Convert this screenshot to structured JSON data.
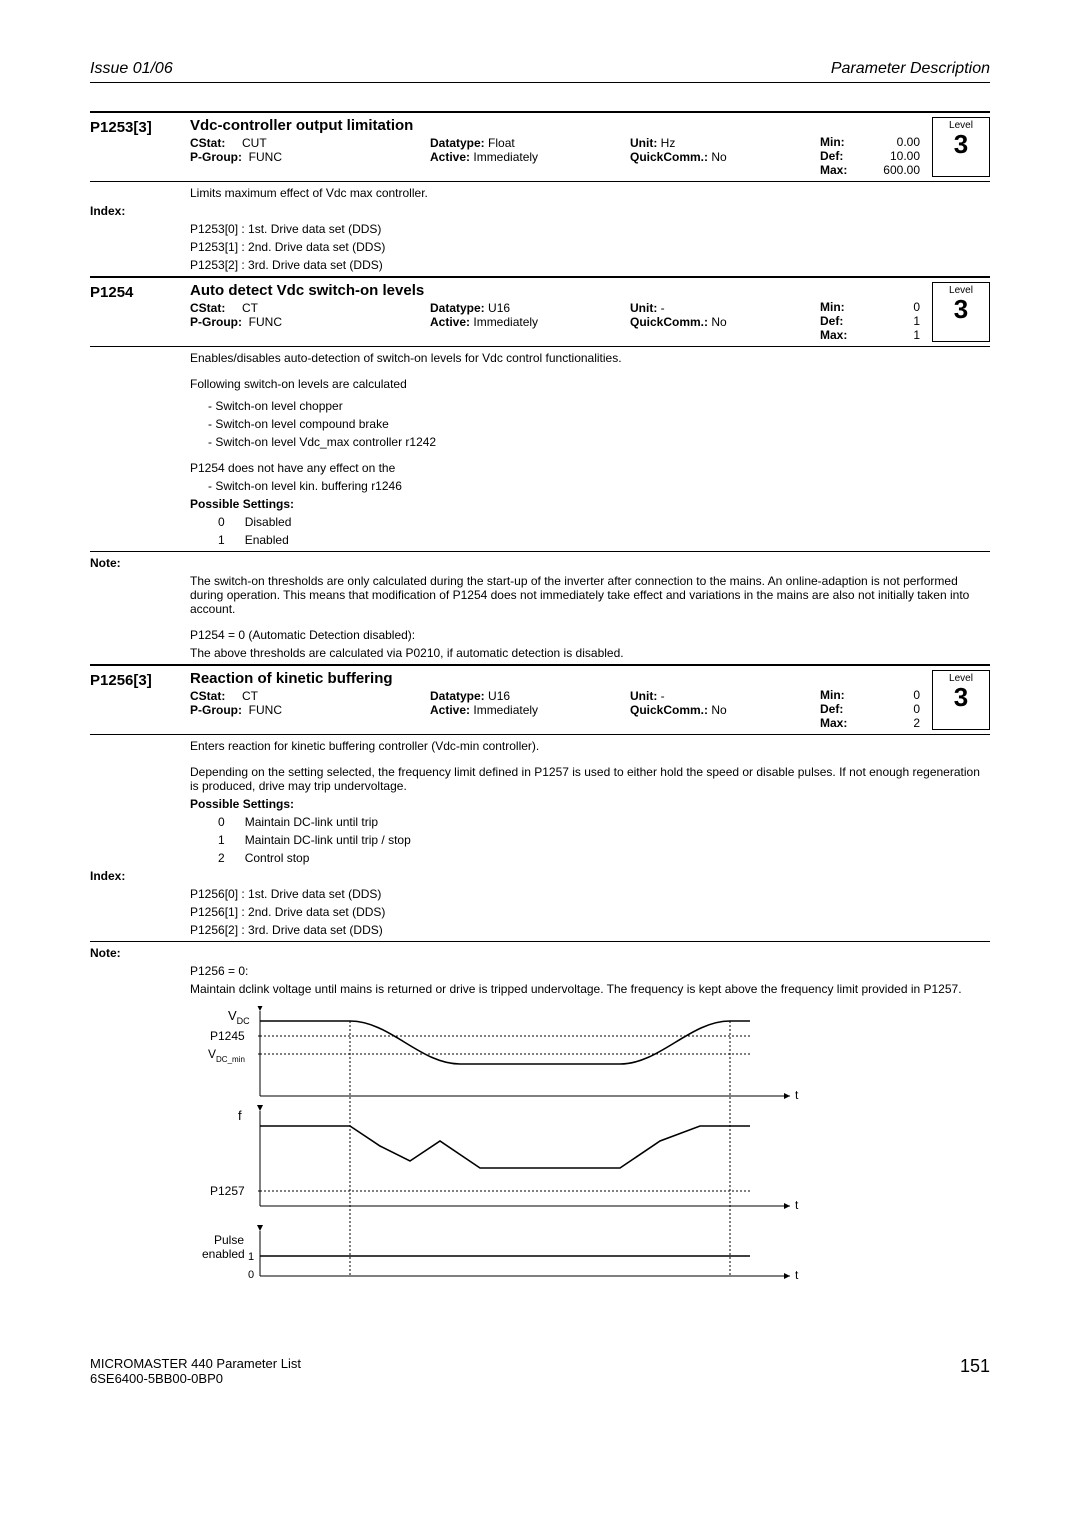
{
  "header": {
    "left": "Issue 01/06",
    "right": "Parameter Description"
  },
  "p1253": {
    "id": "P1253[3]",
    "title": "Vdc-controller output limitation",
    "cstat_l": "CStat:",
    "cstat": "CUT",
    "datatype_l": "Datatype:",
    "datatype": "Float",
    "unit_l": "Unit:",
    "unit": "Hz",
    "pgroup_l": "P-Group:",
    "pgroup": "FUNC",
    "active_l": "Active:",
    "active": "Immediately",
    "quick_l": "QuickComm.:",
    "quick": "No",
    "min_l": "Min:",
    "min": "0.00",
    "def_l": "Def:",
    "def": "10.00",
    "max_l": "Max:",
    "max": "600.00",
    "level_l": "Level",
    "level": "3",
    "desc": "Limits maximum effect of Vdc max controller.",
    "index_l": "Index:",
    "idx0": "P1253[0] :  1st. Drive data set (DDS)",
    "idx1": "P1253[1] :  2nd. Drive data set (DDS)",
    "idx2": "P1253[2] :  3rd. Drive data set (DDS)"
  },
  "p1254": {
    "id": "P1254",
    "title": "Auto detect Vdc switch-on levels",
    "cstat_l": "CStat:",
    "cstat": "CT",
    "datatype_l": "Datatype:",
    "datatype": "U16",
    "unit_l": "Unit:",
    "unit": "-",
    "pgroup_l": "P-Group:",
    "pgroup": "FUNC",
    "active_l": "Active:",
    "active": "Immediately",
    "quick_l": "QuickComm.:",
    "quick": "No",
    "min_l": "Min:",
    "min": "0",
    "def_l": "Def:",
    "def": "1",
    "max_l": "Max:",
    "max": "1",
    "level_l": "Level",
    "level": "3",
    "desc1": "Enables/disables auto-detection of switch-on levels for Vdc control functionalities.",
    "desc2": "Following switch-on levels are calculated",
    "li1": "-   Switch-on level chopper",
    "li2": "-   Switch-on level compound brake",
    "li3": "-   Switch-on level Vdc_max controller r1242",
    "desc3": "P1254 does not have any effect on the",
    "li4": "-   Switch-on level kin. buffering r1246",
    "poss_l": "Possible Settings:",
    "opt0_n": "0",
    "opt0_t": "Disabled",
    "opt1_n": "1",
    "opt1_t": "Enabled",
    "note_l": "Note:",
    "note1": "The switch-on thresholds are only calculated during the start-up of the inverter after connection to the mains. An online-adaption is not performed during operation. This means that modification of P1254 does not immediately take effect and variations in the mains are also not initially taken into account.",
    "note2a": "P1254 = 0 (Automatic Detection disabled):",
    "note2b": "The above thresholds are calculated via P0210, if automatic detection is disabled."
  },
  "p1256": {
    "id": "P1256[3]",
    "title": "Reaction of kinetic buffering",
    "cstat_l": "CStat:",
    "cstat": "CT",
    "datatype_l": "Datatype:",
    "datatype": "U16",
    "unit_l": "Unit:",
    "unit": "-",
    "pgroup_l": "P-Group:",
    "pgroup": "FUNC",
    "active_l": "Active:",
    "active": "Immediately",
    "quick_l": "QuickComm.:",
    "quick": "No",
    "min_l": "Min:",
    "min": "0",
    "def_l": "Def:",
    "def": "0",
    "max_l": "Max:",
    "max": "2",
    "level_l": "Level",
    "level": "3",
    "desc1": "Enters reaction for kinetic buffering controller (Vdc-min controller).",
    "desc2": "Depending on the setting selected, the frequency limit defined in P1257 is used to either hold the speed or disable pulses. If not enough regeneration is produced, drive may trip undervoltage.",
    "poss_l": "Possible Settings:",
    "opt0_n": "0",
    "opt0_t": "Maintain DC-link until trip",
    "opt1_n": "1",
    "opt1_t": "Maintain DC-link until trip / stop",
    "opt2_n": "2",
    "opt2_t": "Control stop",
    "index_l": "Index:",
    "idx0": "P1256[0] :  1st. Drive data set (DDS)",
    "idx1": "P1256[1] :  2nd. Drive data set (DDS)",
    "idx2": "P1256[2] :  3rd. Drive data set (DDS)",
    "note_l": "Note:",
    "note1a": "P1256 = 0:",
    "note1b": "Maintain dclink voltage until mains is returned or drive is tripped undervoltage. The frequency is kept above the frequency limit provided in P1257."
  },
  "chart_data": {
    "type": "line",
    "title": "",
    "panels": [
      {
        "ylabel": "V_DC",
        "ytick_labels": [
          "P1245",
          "V_DC_min"
        ],
        "xlabel": "t",
        "series": [
          {
            "name": "V_DC",
            "x": [
              0,
              1,
              2,
              3,
              4,
              5,
              6,
              7,
              8,
              9,
              10
            ],
            "y": [
              48,
              48,
              44,
              38,
              34,
              34,
              34,
              34,
              38,
              44,
              48
            ]
          },
          {
            "name": "P1245",
            "style": "dotted",
            "x": [
              0,
              10
            ],
            "y": [
              40,
              40
            ]
          },
          {
            "name": "V_DC_min",
            "style": "dotted",
            "x": [
              0,
              10
            ],
            "y": [
              32,
              32
            ]
          }
        ],
        "ylim": [
          30,
          50
        ]
      },
      {
        "ylabel": "f",
        "ytick_labels": [
          "P1257"
        ],
        "xlabel": "t",
        "series": [
          {
            "name": "f",
            "x": [
              0,
              1,
              2,
              3,
              4,
              5,
              6,
              7,
              8,
              9,
              10
            ],
            "y": [
              40,
              40,
              36,
              28,
              24,
              24,
              24,
              24,
              28,
              36,
              40
            ]
          },
          {
            "name": "P1257",
            "style": "dotted",
            "x": [
              0,
              10
            ],
            "y": [
              16,
              16
            ]
          }
        ],
        "ylim": [
          10,
          45
        ]
      },
      {
        "ylabel": "Pulse enabled",
        "xlabel": "t",
        "series": [
          {
            "name": "pulse",
            "x": [
              0,
              10
            ],
            "y": [
              1,
              1
            ]
          }
        ],
        "yticks": [
          0,
          1
        ],
        "ylim": [
          0,
          1.2
        ]
      }
    ]
  },
  "svg_labels": {
    "vdc": "V",
    "vdc_sub": "DC",
    "p1245": "P1245",
    "vdcmin": "V",
    "vdcmin_sub": "DC_min",
    "f": "f",
    "p1257": "P1257",
    "pulse": "Pulse",
    "enabled": "enabled",
    "one": "1",
    "zero": "0",
    "t": "t"
  },
  "footer": {
    "l1": "MICROMASTER 440    Parameter List",
    "l2": "6SE6400-5BB00-0BP0",
    "page": "151"
  }
}
